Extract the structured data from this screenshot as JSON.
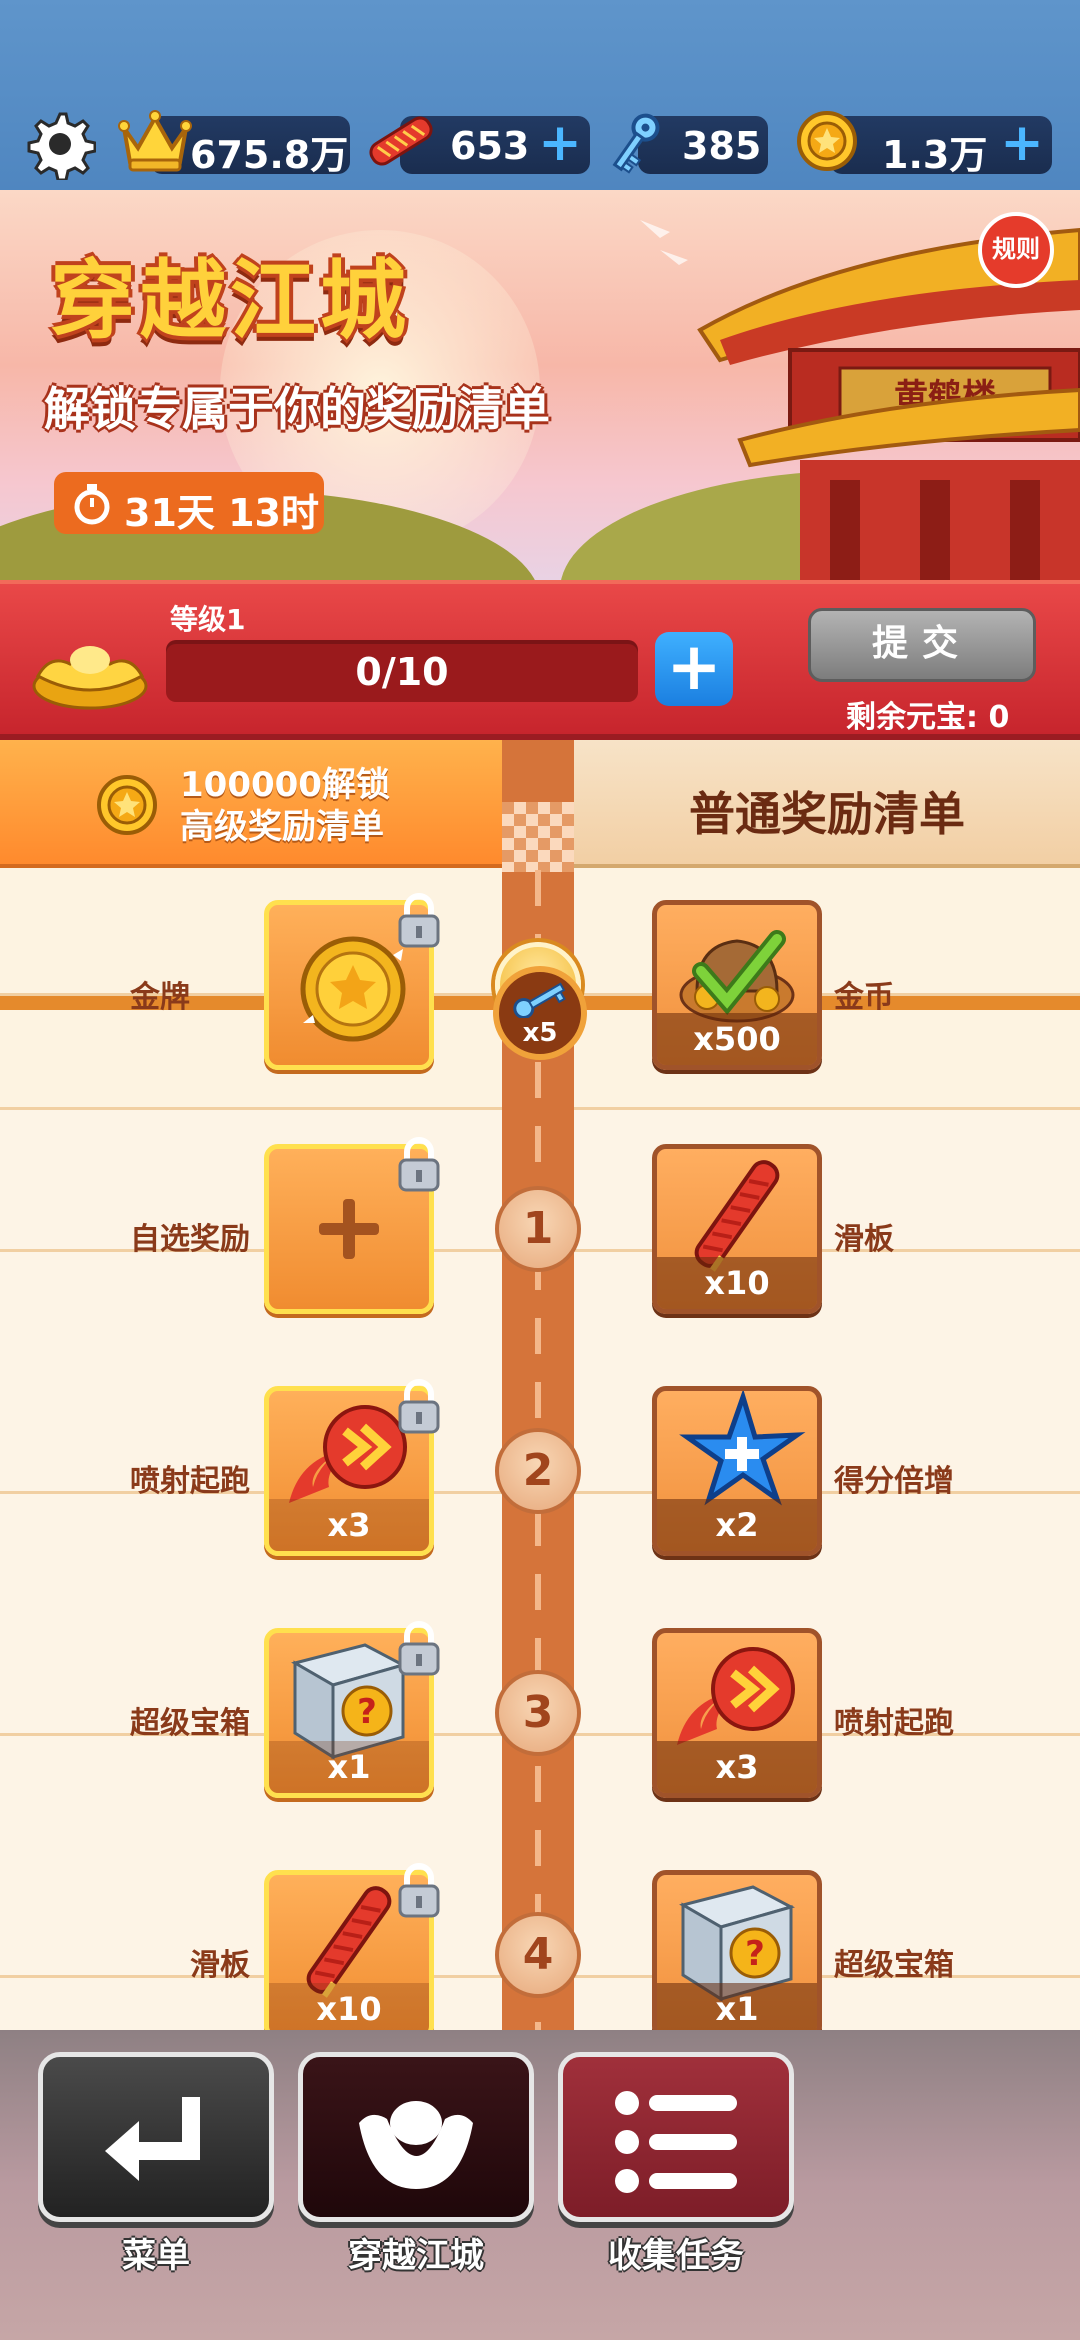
{
  "topbar": {
    "crowns": "675.8万",
    "boards": "653",
    "keys": "385",
    "coins": "1.3万"
  },
  "banner": {
    "title": "穿越江城",
    "subtitle": "解锁专属于你的奖励清单",
    "timer": "31天 13时",
    "rules": "规则",
    "plaque": "黄鹤楼"
  },
  "level": {
    "label": "等级1",
    "progress_text": "0/10",
    "progress_fraction": 0,
    "submit": "提交",
    "remaining": "剩余元宝: 0"
  },
  "list": {
    "premium_header": [
      "100000解锁",
      "高级奖励清单"
    ],
    "normal_header": "普通奖励清单",
    "key_badge": "x5",
    "rows": [
      {
        "node": "0",
        "premium": {
          "name": "金牌",
          "icon": "gold-medal",
          "qty": ""
        },
        "normal": {
          "name": "金币",
          "icon": "coin-bag",
          "qty": "x500"
        }
      },
      {
        "node": "1",
        "premium": {
          "name": "自选奖励",
          "icon": "plus",
          "qty": ""
        },
        "normal": {
          "name": "滑板",
          "icon": "hoverboard",
          "qty": "x10"
        }
      },
      {
        "node": "2",
        "premium": {
          "name": "喷射起跑",
          "icon": "jet-start",
          "qty": "x3"
        },
        "normal": {
          "name": "得分倍增",
          "icon": "score-star",
          "qty": "x2"
        }
      },
      {
        "node": "3",
        "premium": {
          "name": "超级宝箱",
          "icon": "mystery-box",
          "qty": "x1"
        },
        "normal": {
          "name": "喷射起跑",
          "icon": "jet-start",
          "qty": "x3"
        }
      },
      {
        "node": "4",
        "premium": {
          "name": "滑板",
          "icon": "hoverboard",
          "qty": "x10"
        },
        "normal": {
          "name": "超级宝箱",
          "icon": "mystery-box",
          "qty": "x1"
        }
      }
    ]
  },
  "nav": {
    "menu": "菜单",
    "event": "穿越江城",
    "tasks": "收集任务"
  }
}
